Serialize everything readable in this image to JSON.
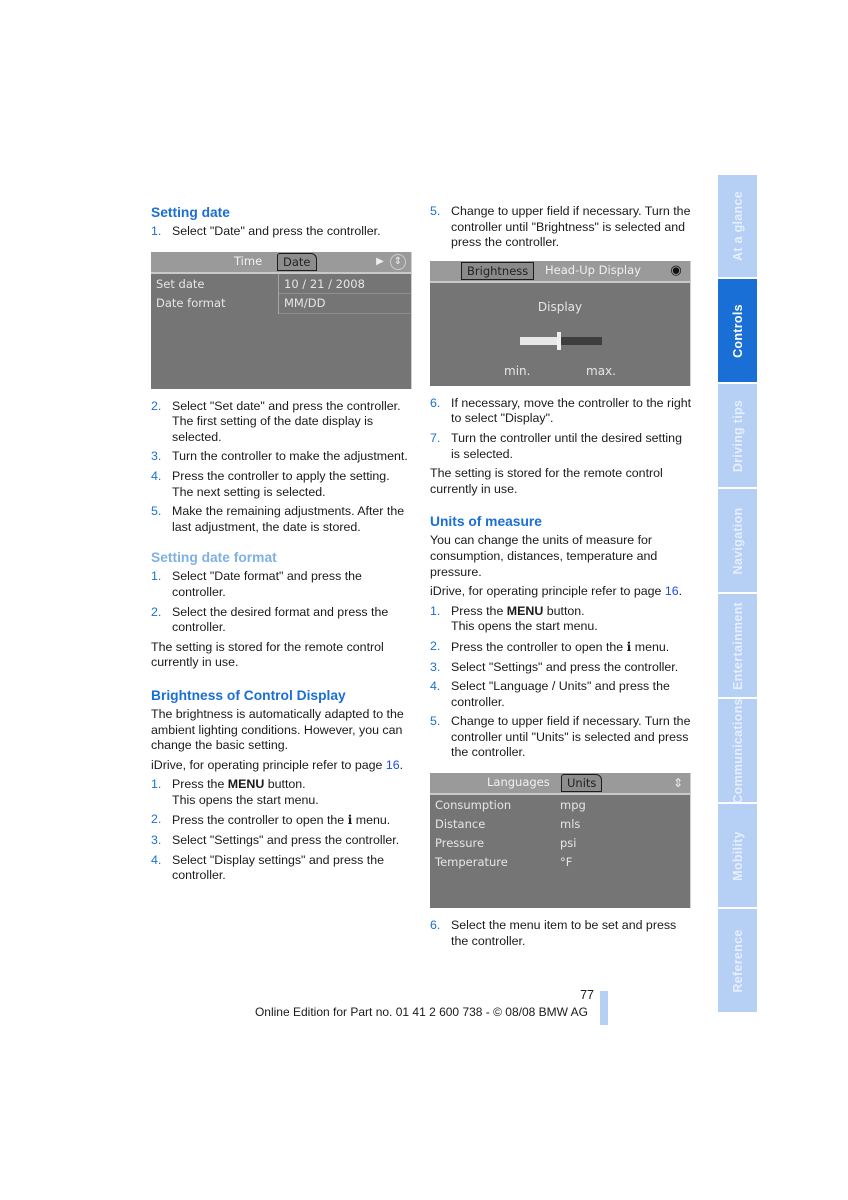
{
  "left_column": {
    "setting_date": {
      "heading": "Setting date",
      "steps_before": [
        {
          "num": "1.",
          "text": "Select \"Date\" and press the controller."
        }
      ],
      "screen": {
        "tabs": [
          "Time",
          "Date"
        ],
        "active_tab": "Date",
        "icons": [
          "play-arrow-icon",
          "controller-icon"
        ],
        "rows": [
          {
            "label": "Set date",
            "value": "10 / 21 / 2008"
          },
          {
            "label": "Date format",
            "value": "MM/DD"
          }
        ]
      },
      "steps_after": [
        {
          "num": "2.",
          "text": "Select \"Set date\" and press the controller. The first setting of the date display is selected."
        },
        {
          "num": "3.",
          "text": "Turn the controller to make the adjustment."
        },
        {
          "num": "4.",
          "text": "Press the controller to apply the setting. The next setting is selected."
        },
        {
          "num": "5.",
          "text": "Make the remaining adjustments. After the last adjustment, the date is stored."
        }
      ]
    },
    "setting_date_format": {
      "heading": "Setting date format",
      "steps": [
        {
          "num": "1.",
          "text": "Select \"Date format\" and press the controller."
        },
        {
          "num": "2.",
          "text": "Select the desired format and press the controller."
        }
      ],
      "note": "The setting is stored for the remote control currently in use."
    },
    "brightness": {
      "heading": "Brightness of Control Display",
      "intro": "The brightness is automatically adapted to the ambient lighting conditions. However, you can change the basic setting.",
      "idrive_ref": "iDrive, for operating principle refer to page ",
      "idrive_page": "16",
      "idrive_end": ".",
      "steps": [
        {
          "num": "1.",
          "pre": "Press the ",
          "bold": "MENU",
          "post": " button.",
          "line2": "This opens the start menu."
        },
        {
          "num": "2.",
          "pre": "Press the controller to open the ",
          "icon": "i",
          "post": " menu."
        },
        {
          "num": "3.",
          "text": "Select \"Settings\" and press the controller."
        },
        {
          "num": "4.",
          "text": "Select \"Display settings\" and press the controller."
        }
      ]
    }
  },
  "right_column": {
    "brightness_cont": {
      "steps_before": [
        {
          "num": "5.",
          "text": "Change to upper field if necessary. Turn the controller until \"Brightness\" is selected and press the controller."
        }
      ],
      "screen": {
        "tabs": [
          "Brightness",
          "Head-Up Display"
        ],
        "active_tab": "Brightness",
        "title": "Display",
        "slider_value_pct": 47,
        "min_label": "min.",
        "max_label": "max."
      },
      "steps_after": [
        {
          "num": "6.",
          "text": "If necessary, move the controller to the right to select \"Display\"."
        },
        {
          "num": "7.",
          "text": "Turn the controller until the desired setting is selected."
        }
      ],
      "note": "The setting is stored for the remote control currently in use."
    },
    "units": {
      "heading": "Units of measure",
      "intro": "You can change the units of measure for consumption, distances, temperature and pressure.",
      "idrive_ref": "iDrive, for operating principle refer to page ",
      "idrive_page": "16",
      "idrive_end": ".",
      "steps": [
        {
          "num": "1.",
          "pre": "Press the ",
          "bold": "MENU",
          "post": " button.",
          "line2": "This opens the start menu."
        },
        {
          "num": "2.",
          "pre": "Press the controller to open the ",
          "icon": "i",
          "post": " menu."
        },
        {
          "num": "3.",
          "text": "Select \"Settings\" and press the controller."
        },
        {
          "num": "4.",
          "text": "Select \"Language / Units\" and press the controller."
        },
        {
          "num": "5.",
          "text": "Change to upper field if necessary. Turn the controller until \"Units\" is selected and press the controller."
        }
      ],
      "screen": {
        "tabs": [
          "Languages",
          "Units"
        ],
        "active_tab": "Units",
        "rows": [
          {
            "label": "Consumption",
            "value": "mpg"
          },
          {
            "label": "Distance",
            "value": "mls"
          },
          {
            "label": "Pressure",
            "value": "psi"
          },
          {
            "label": "Temperature",
            "value": "°F"
          }
        ]
      },
      "steps_after": [
        {
          "num": "6.",
          "text": "Select the menu item to be set and press the controller."
        }
      ]
    }
  },
  "sidebar": {
    "tabs": [
      "At a glance",
      "Controls",
      "Driving tips",
      "Navigation",
      "Entertainment",
      "Communications",
      "Mobility",
      "Reference"
    ],
    "active": "Controls"
  },
  "footer": {
    "page_number": "77",
    "text": "Online Edition for Part no. 01 41 2 600 738 - © 08/08 BMW AG"
  },
  "colors": {
    "heading_blue": "#1a6fd6",
    "subheading_light_blue": "#7fb0e6",
    "sidebar_tab": "#b5cff5",
    "sidebar_active": "#1a6fd6",
    "screen_bg": "#757575"
  }
}
